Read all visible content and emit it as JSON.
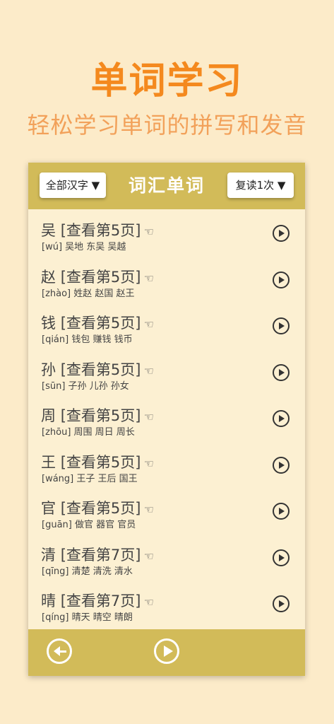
{
  "hero": {
    "title": "单词学习",
    "subtitle": "轻松学习单词的拼写和发音"
  },
  "header": {
    "filter_label": "全部汉字 ▼",
    "title": "词汇单词",
    "repeat_label": "复读1次 ▼"
  },
  "words": [
    {
      "char": "吴",
      "page": "[查看第5页]",
      "pointer": "☜",
      "pinyin": "[wú]",
      "examples": "吴地 东吴 吴越"
    },
    {
      "char": "赵",
      "page": "[查看第5页]",
      "pointer": "☜",
      "pinyin": "[zhào]",
      "examples": "姓赵 赵国 赵王"
    },
    {
      "char": "钱",
      "page": "[查看第5页]",
      "pointer": "☜",
      "pinyin": "[qián]",
      "examples": "钱包 赚钱 钱币"
    },
    {
      "char": "孙",
      "page": "[查看第5页]",
      "pointer": "☜",
      "pinyin": "[sūn]",
      "examples": "子孙 儿孙 孙女"
    },
    {
      "char": "周",
      "page": "[查看第5页]",
      "pointer": "☜",
      "pinyin": "[zhōu]",
      "examples": "周围 周日 周长"
    },
    {
      "char": "王",
      "page": "[查看第5页]",
      "pointer": "☜",
      "pinyin": "[wáng]",
      "examples": "王子 王后 国王"
    },
    {
      "char": "官",
      "page": "[查看第5页]",
      "pointer": "☜",
      "pinyin": "[guān]",
      "examples": "做官 器官 官员"
    },
    {
      "char": "清",
      "page": "[查看第7页]",
      "pointer": "☜",
      "pinyin": "[qīng]",
      "examples": "清楚 清洗 清水"
    },
    {
      "char": "晴",
      "page": "[查看第7页]",
      "pointer": "☜",
      "pinyin": "[qíng]",
      "examples": "晴天 晴空 晴朗"
    }
  ],
  "icons": {
    "row_play": "play-circle-icon",
    "back": "back-arrow-icon",
    "footer_play": "play-circle-icon"
  },
  "colors": {
    "accent": "#f4891e",
    "bar": "#d2bb59",
    "background": "#fcebc9"
  }
}
